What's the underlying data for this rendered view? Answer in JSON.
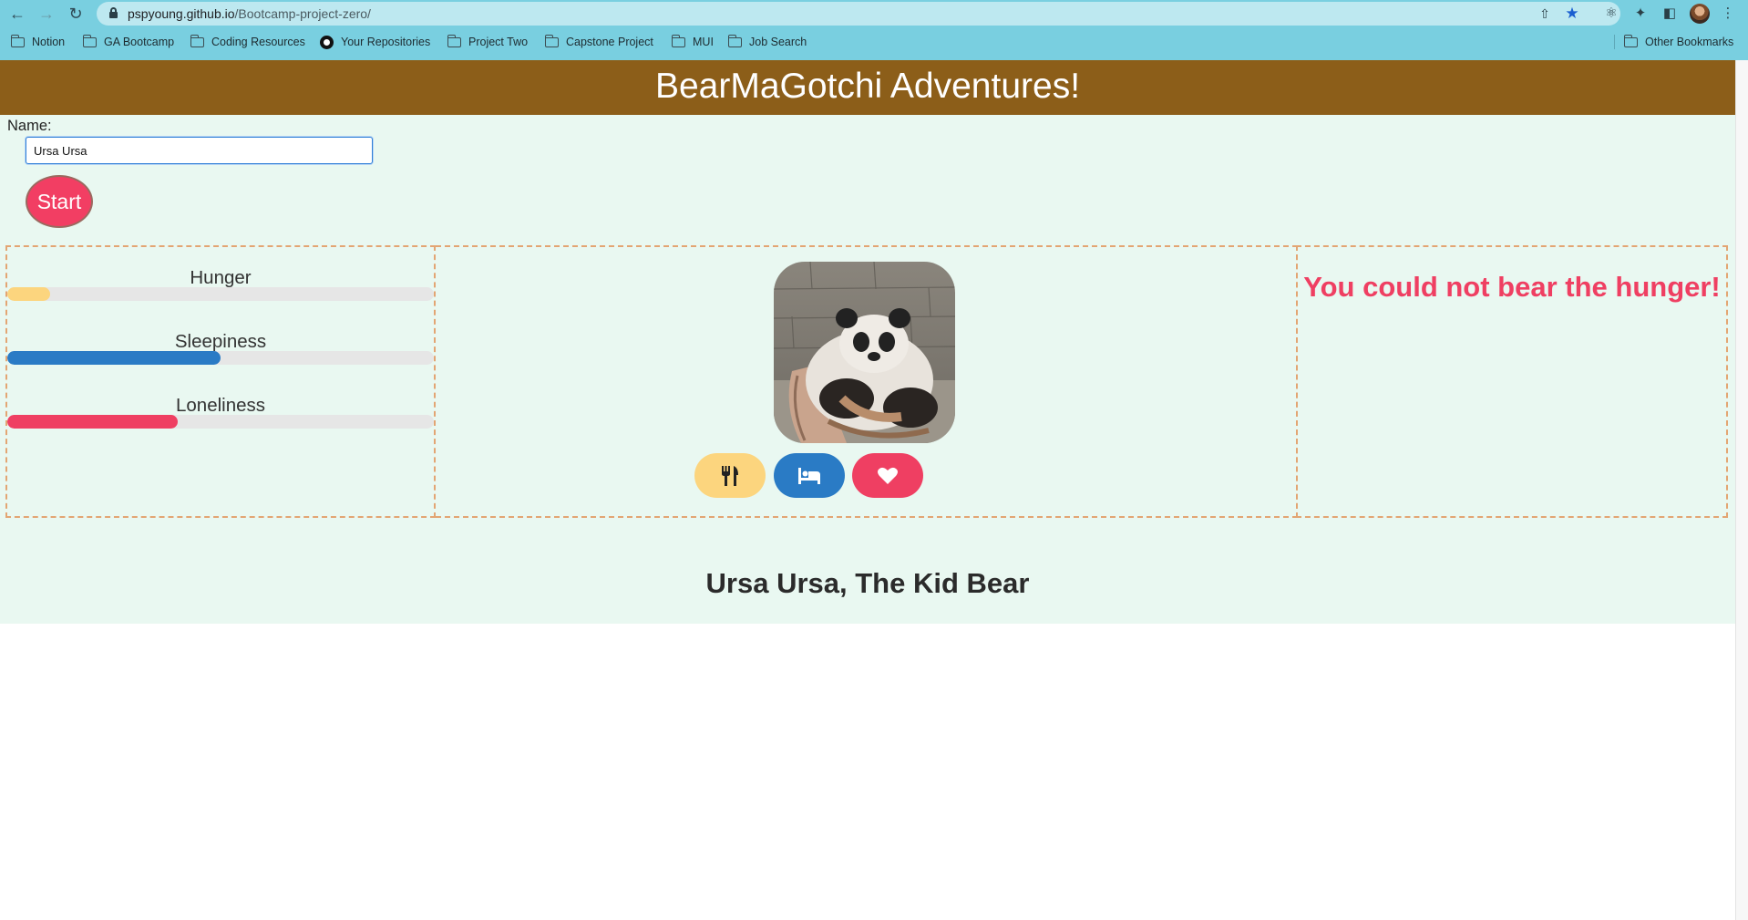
{
  "browser": {
    "url_host": "pspyoung.github.io",
    "url_path": "/Bootcamp-project-zero/",
    "bookmarks": [
      "Notion",
      "GA Bootcamp",
      "Coding Resources",
      "Your Repositories",
      "Project Two",
      "Capstone Project",
      "MUI",
      "Job Search"
    ],
    "other_bookmarks": "Other Bookmarks"
  },
  "header": {
    "title": "BearMaGotchi Adventures!"
  },
  "form": {
    "name_label": "Name:",
    "name_value": "Ursa Ursa",
    "start_label": "Start"
  },
  "stats": [
    {
      "label": "Hunger",
      "level": 0.1,
      "color": "#fcd57e"
    },
    {
      "label": "Sleepiness",
      "level": 0.5,
      "color": "#2a7bc5"
    },
    {
      "label": "Loneliness",
      "level": 0.4,
      "color": "#ef3f62"
    }
  ],
  "actions": [
    {
      "name": "feed",
      "icon": "utensils-icon",
      "color": "#fcd57e"
    },
    {
      "name": "sleep",
      "icon": "bed-icon",
      "color": "#2a7bc5"
    },
    {
      "name": "play",
      "icon": "heart-icon",
      "color": "#ef3f62"
    }
  ],
  "status_message": "You could not bear the hunger!",
  "bear_title": "Ursa Ursa, The Kid Bear"
}
